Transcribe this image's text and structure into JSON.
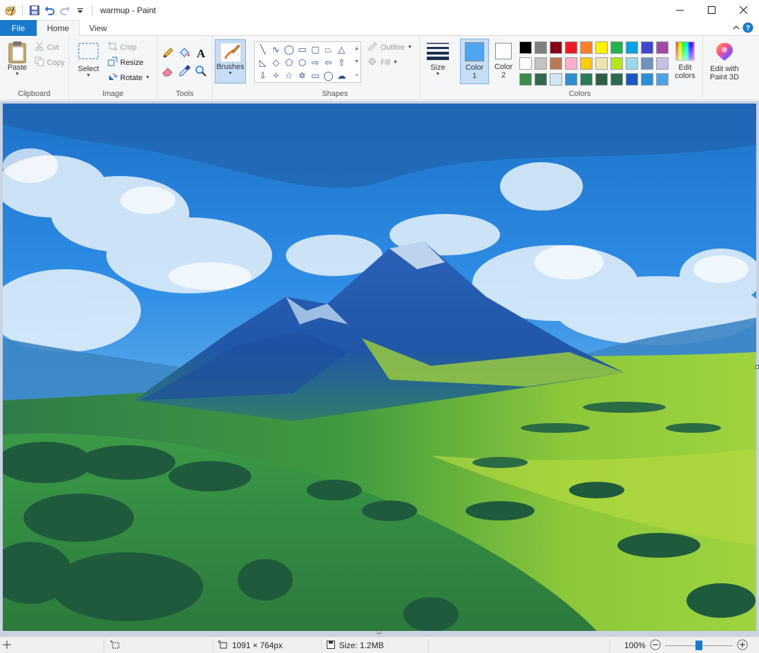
{
  "app": {
    "title": "warmup - Paint"
  },
  "tabs": [
    {
      "label": "File"
    },
    {
      "label": "Home"
    },
    {
      "label": "View"
    }
  ],
  "ribbon": {
    "clipboard": {
      "group_label": "Clipboard",
      "paste": "Paste",
      "cut": "Cut",
      "copy": "Copy"
    },
    "image": {
      "group_label": "Image",
      "select": "Select",
      "crop": "Crop",
      "resize": "Resize",
      "rotate": "Rotate"
    },
    "tools": {
      "group_label": "Tools"
    },
    "brushes": {
      "label": "Brushes"
    },
    "shapes": {
      "group_label": "Shapes",
      "outline": "Outline",
      "fill": "Fill"
    },
    "size": {
      "label": "Size"
    },
    "colors": {
      "group_label": "Colors",
      "color1_label": "Color",
      "color1_num": "1",
      "color2_label": "Color",
      "color2_num": "2",
      "color1_value": "#4ea6f0",
      "color2_value": "#ffffff",
      "edit_colors_line1": "Edit",
      "edit_colors_line2": "colors",
      "palette": [
        "#000000",
        "#7f7f7f",
        "#880015",
        "#ed1c24",
        "#ff7f27",
        "#fff200",
        "#22b14c",
        "#00a2e8",
        "#3f48cc",
        "#a349a4",
        "#ffffff",
        "#c3c3c3",
        "#b97a57",
        "#ffaec9",
        "#ffc90e",
        "#efe4b0",
        "#b5e61d",
        "#99d9ea",
        "#7092be",
        "#c8bfe7",
        "#3d8b4a",
        "#2f6a4e",
        "#cfe6f7",
        "#2e8fd1",
        "#2b7a5a",
        "#2f5e45",
        "#2d6b4e",
        "#1c56c4",
        "#2b8fd8",
        "#4aa3ea"
      ]
    },
    "paint3d": {
      "line1": "Edit with",
      "line2": "Paint 3D"
    }
  },
  "status": {
    "dimensions": "1091 × 764px",
    "size": "Size: 1.2MB",
    "zoom": "100%"
  },
  "icons": [
    "app-paint-icon",
    "save-icon",
    "undo-icon",
    "redo-icon",
    "customize-qat-icon",
    "minimize-icon",
    "maximize-icon",
    "close-icon",
    "collapse-ribbon-icon",
    "help-icon",
    "pencil-icon",
    "fill-bucket-icon",
    "text-icon",
    "eraser-icon",
    "color-picker-icon",
    "magnifier-icon"
  ]
}
